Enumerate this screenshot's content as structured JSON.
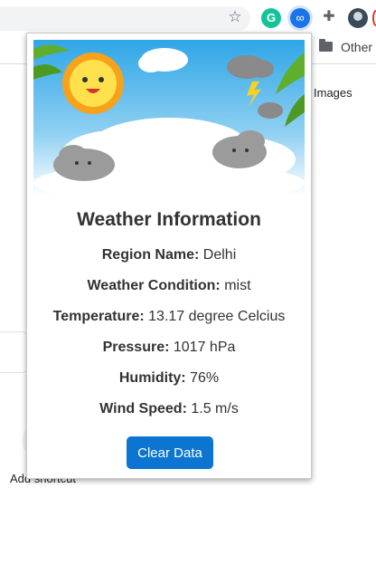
{
  "browser": {
    "extension_grammarly_letter": "G",
    "bookmarks_other_label": "Other",
    "images_link": "Images",
    "add_shortcut_label": "Add shortcut"
  },
  "popup": {
    "title": "Weather Information",
    "rows": [
      {
        "label": "Region Name:",
        "value": "Delhi"
      },
      {
        "label": "Weather Condition:",
        "value": "mist"
      },
      {
        "label": "Temperature:",
        "value": "13.17 degree Celcius"
      },
      {
        "label": "Pressure:",
        "value": "1017 hPa"
      },
      {
        "label": "Humidity:",
        "value": "76%"
      },
      {
        "label": "Wind Speed:",
        "value": "1.5 m/s"
      }
    ],
    "clear_button_label": "Clear Data",
    "button_color": "#0b75d1"
  }
}
